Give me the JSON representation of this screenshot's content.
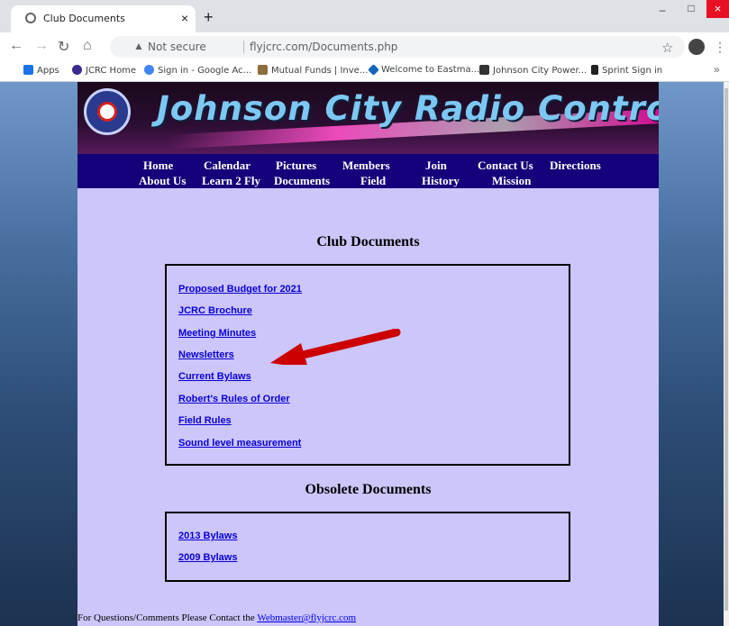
{
  "browser": {
    "tab_title": "Club Documents",
    "tab_close": "×",
    "new_tab": "+",
    "window_minimize": "–",
    "window_maximize": "□",
    "window_close": "×",
    "security_label": "Not secure",
    "url": "flyjcrc.com/Documents.php",
    "bookmarks": [
      {
        "label": "Apps",
        "icon_color": "#1a73e8"
      },
      {
        "label": "JCRC Home",
        "icon_color": "#3b2a8e"
      },
      {
        "label": "Sign in - Google Ac...",
        "icon_color": "#4285f4"
      },
      {
        "label": "Mutual Funds | Inve...",
        "icon_color": "#8d6e3f"
      },
      {
        "label": "Welcome to Eastma...",
        "icon_color": "#1565c0"
      },
      {
        "label": "Johnson City Power...",
        "icon_color": "#333333"
      },
      {
        "label": "Sprint Sign in",
        "icon_color": "#222222"
      }
    ],
    "bookmarks_more": "»"
  },
  "site": {
    "title": "Johnson City Radio Controllers",
    "nav_row1": [
      "Home",
      "Calendar",
      "Pictures",
      "Members",
      "Join",
      "Contact Us",
      "Directions"
    ],
    "nav_row2": [
      "About Us",
      "Learn 2 Fly",
      "Documents",
      "Field",
      "History",
      "Mission"
    ]
  },
  "club_documents": {
    "heading": "Club Documents",
    "links": [
      "Proposed Budget for 2021",
      "JCRC Brochure",
      "Meeting Minutes",
      "Newsletters",
      "Current Bylaws",
      "Robert's Rules of Order",
      "Field Rules",
      "Sound level measurement"
    ]
  },
  "obsolete_documents": {
    "heading": "Obsolete Documents",
    "links": [
      "2013 Bylaws",
      "2009 Bylaws"
    ]
  },
  "footer": {
    "text": "For Questions/Comments Please Contact the ",
    "email": "Webmaster@flyjcrc.com"
  },
  "colors": {
    "page_background": "#ccc6fb",
    "nav_background": "#14007a",
    "link": "#0a00d4",
    "title": "#7cc8f2",
    "annotation_arrow": "#cc0000"
  }
}
